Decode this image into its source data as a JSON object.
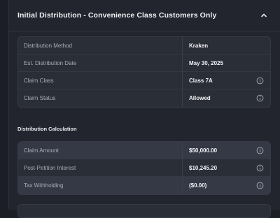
{
  "header": {
    "title": "Initial Distribution - Convenience Class Customers Only"
  },
  "details": [
    {
      "label": "Distribution Method",
      "value": "Kraken",
      "info": false
    },
    {
      "label": "Est. Distribution Date",
      "value": "May 30, 2025",
      "info": false
    },
    {
      "label": "Claim Class",
      "value": "Class 7A",
      "info": true
    },
    {
      "label": "Claim Status",
      "value": "Allowed",
      "info": true
    }
  ],
  "calculation": {
    "title": "Distribution Calculation",
    "rows": [
      {
        "label": "Claim Amount",
        "value": "$50,000.00",
        "info": true
      },
      {
        "label": "Post-Petition Interest",
        "value": "$10,245.20",
        "info": true
      },
      {
        "label": "Tax Withholding",
        "value": "($0.00)",
        "info": true
      }
    ]
  },
  "icons": {
    "collapse": "chevron-up-icon",
    "info": "info-circle-icon"
  },
  "colors": {
    "background": "#1b1e25",
    "panel": "#22252d",
    "card": "#2a2e37",
    "highlight_row": "#353945"
  }
}
